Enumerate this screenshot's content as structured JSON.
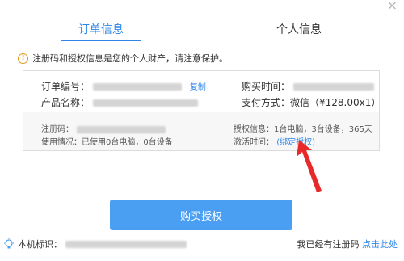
{
  "tabs": {
    "order": "订单信息",
    "personal": "个人信息"
  },
  "notice": "注册码和授权信息是您的个人财产，请注意保护。",
  "order": {
    "order_no_label": "订单编号：",
    "copy_label": "复制",
    "purchase_time_label": "购买时间：",
    "product_label": "产品名称：",
    "pay_label": "支付方式：微信（¥128.00x1）"
  },
  "details": {
    "reg_code_label": "注册码：",
    "usage_label": "使用情况：已使用0台电脑，0台设备",
    "license_label": "授权信息：1台电脑，3台设备，365天",
    "activate_label": "激活时间：",
    "bind_link": "(绑定授权)"
  },
  "buy_button": "购买授权",
  "footer": {
    "machine_id_label": "本机标识：",
    "has_code_text": "我已经有注册码",
    "click_here": "点击此处"
  },
  "colors": {
    "accent": "#2f86e8",
    "button": "#4b9ff2",
    "arrow": "#e8292a"
  }
}
